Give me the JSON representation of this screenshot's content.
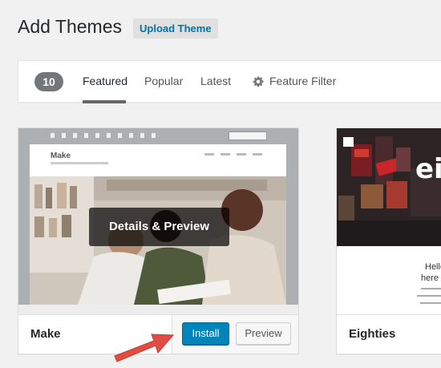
{
  "header": {
    "title": "Add Themes",
    "upload_label": "Upload Theme"
  },
  "filter_bar": {
    "count": "10",
    "tabs": [
      {
        "label": "Featured",
        "active": true
      },
      {
        "label": "Popular",
        "active": false
      },
      {
        "label": "Latest",
        "active": false
      }
    ],
    "feature_filter_label": "Feature Filter",
    "feature_filter_icon": "gear-icon"
  },
  "themes": [
    {
      "name": "Make",
      "overlay_label": "Details & Preview",
      "install_label": "Install",
      "preview_label": "Preview",
      "screenshot": {
        "logo_text": "Make"
      }
    },
    {
      "name": "Eighties",
      "screenshot": {
        "big_text": "ei",
        "hello_text": "Hello",
        "here_text": "here ’"
      }
    }
  ],
  "annotation": {
    "arrow_color": "#e14d43",
    "arrow_icon": "red-arrow-pointing-to-install"
  },
  "colors": {
    "accent": "#0085ba",
    "link": "#0073aa"
  }
}
